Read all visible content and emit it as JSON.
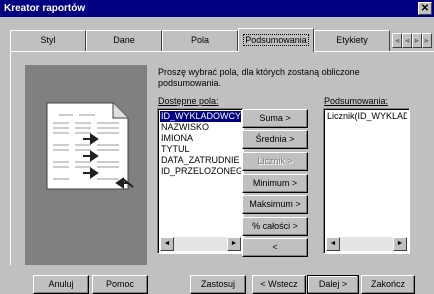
{
  "window": {
    "title": "Kreator raportów",
    "close_glyph": "✕"
  },
  "tabs": [
    {
      "label": "Styl"
    },
    {
      "label": "Dane"
    },
    {
      "label": "Pola"
    },
    {
      "label": "Podsumowania"
    },
    {
      "label": "Etykiety"
    }
  ],
  "tab_scroll_glyphs": [
    "◄",
    "◄",
    "►",
    "►"
  ],
  "prompt": "Proszę wybrać pola, dla których zostaną obliczone podsumowania.",
  "available_label": "Dostępne pola:",
  "available_fields": [
    "ID_WYKLADOWCY",
    "NAZWISKO",
    "IMIONA",
    "TYTUL",
    "DATA_ZATRUDNIE",
    "ID_PRZELOZONEG"
  ],
  "summary_label": "Podsumowania:",
  "summary_fields": [
    "Licznik(ID_WYKLAD"
  ],
  "actions": {
    "sum": "Suma >",
    "average": "Średnia >",
    "count": "Licznik >",
    "minimum": "Minimum >",
    "maximum": "Maksimum >",
    "percent": "% całości >",
    "remove": "<"
  },
  "buttons": {
    "cancel": "Anuluj",
    "help": "Pomoc",
    "apply": "Zastosuj",
    "back": "< Wstecz",
    "next": "Dalej >",
    "finish": "Zakończ"
  },
  "scroll_glyphs": {
    "left": "◄",
    "right": "►"
  }
}
